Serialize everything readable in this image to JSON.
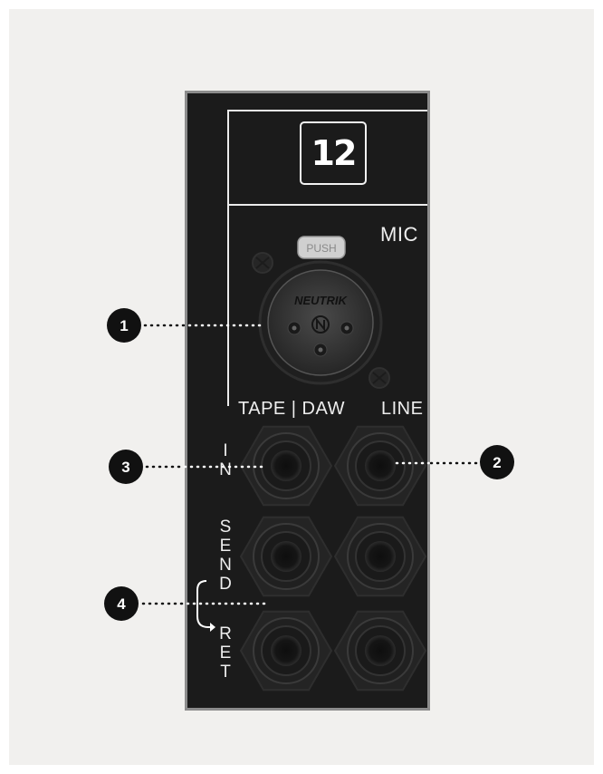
{
  "panel": {
    "channel_number": "12",
    "mic_label": "MIC",
    "push_label": "PUSH",
    "brand": "NEUTRIK",
    "tape_daw_label": "TAPE | DAW",
    "line_label": "LINE",
    "in_letters": [
      "I",
      "N"
    ],
    "send_letters": [
      "S",
      "E",
      "N",
      "D"
    ],
    "ret_letters": [
      "R",
      "E",
      "T"
    ]
  },
  "callouts": [
    "1",
    "2",
    "3",
    "4"
  ],
  "colors": {
    "panel": "#1b1b1b",
    "panel_border": "#8c8c8c",
    "background": "#f1f0ee",
    "marker": "#111111",
    "label_text": "#eeeeee"
  }
}
